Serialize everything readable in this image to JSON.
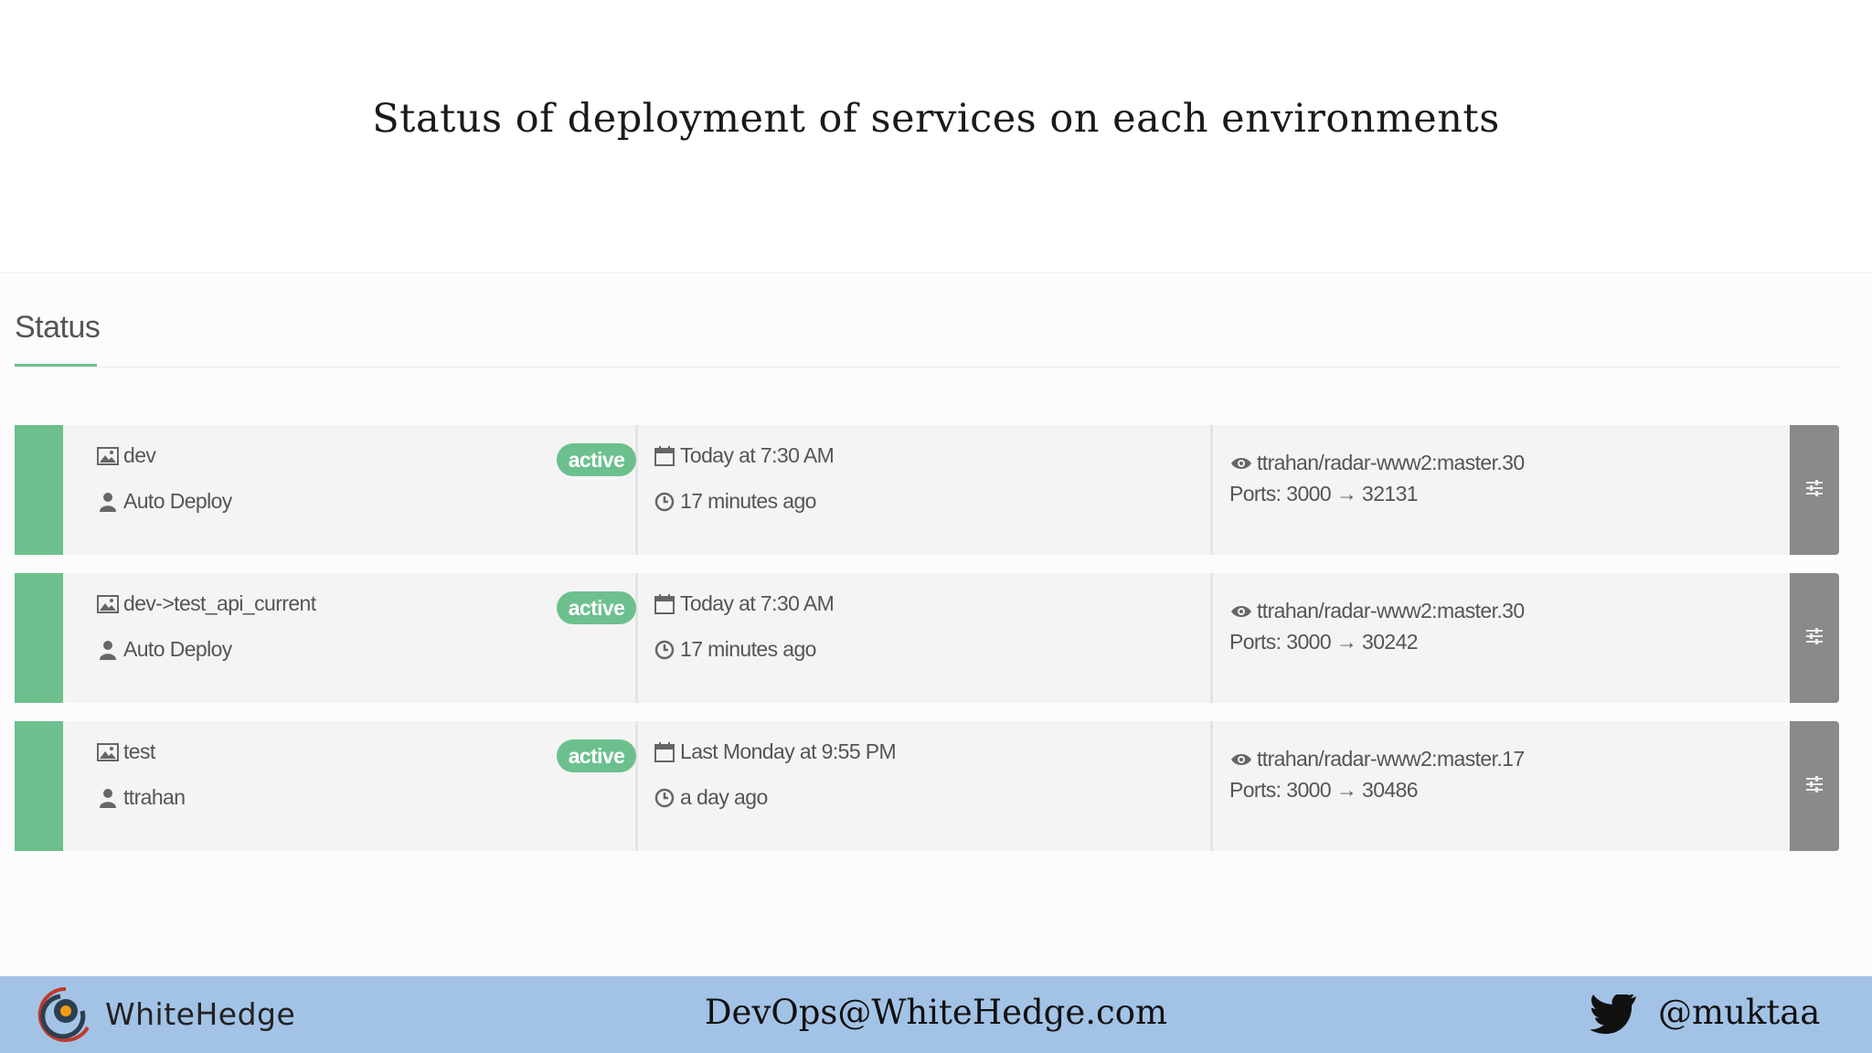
{
  "slide": {
    "title": "Status of deployment of services on each environments"
  },
  "panel": {
    "heading": "Status"
  },
  "colors": {
    "accent": "#6cc08e",
    "action": "#8a8a8a",
    "footer": "#a3c3e6"
  },
  "deployments": [
    {
      "environment": "dev",
      "deployed_by": "Auto Deploy",
      "status": "active",
      "date": "Today at 7:30 AM",
      "relative": "17 minutes ago",
      "image": "ttrahan/radar-www2:master.30",
      "ports": "Ports: 3000 → 32131"
    },
    {
      "environment": "dev->test_api_current",
      "deployed_by": "Auto Deploy",
      "status": "active",
      "date": "Today at 7:30 AM",
      "relative": "17 minutes ago",
      "image": "ttrahan/radar-www2:master.30",
      "ports": "Ports: 3000 → 30242"
    },
    {
      "environment": "test",
      "deployed_by": "ttrahan",
      "status": "active",
      "date": "Last Monday at 9:55 PM",
      "relative": "a day ago",
      "image": "ttrahan/radar-www2:master.17",
      "ports": "Ports: 3000 → 30486"
    }
  ],
  "footer": {
    "brand": "WhiteHedge",
    "email": "DevOps@WhiteHedge.com",
    "handle": "@muktaa",
    "icons": [
      "whitehedge-logo",
      "twitter-bird-icon"
    ]
  }
}
